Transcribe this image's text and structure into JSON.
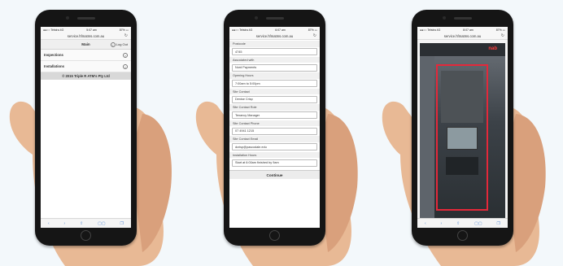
{
  "phones": [
    {
      "status": {
        "carrier": "●●○○ Telstra 4G",
        "time": "5:07 am",
        "battery": "87% ▭"
      },
      "url": "service.hfmatms.com.au",
      "nav": {
        "title": "Main",
        "logout": "Log Out"
      },
      "rows": [
        "Inspections",
        "Installations"
      ],
      "footer": "© 2015 Triple R ATM's Pty Ltd"
    },
    {
      "status": {
        "carrier": "●●○○ Telstra 4G",
        "time": "6:07 am",
        "battery": "87% ▭"
      },
      "url": "service.hfmatms.com.au",
      "fields": [
        {
          "label": "Postcode",
          "value": "4745"
        },
        {
          "label": "Associated with",
          "value": "Nord Payments"
        },
        {
          "label": "Opening Hours",
          "value": "7:00am to 5:00pm"
        },
        {
          "label": "Site Contact",
          "value": "Denise Crisp"
        },
        {
          "label": "Site Contact Role",
          "value": "Tenancy Manager"
        },
        {
          "label": "Site Contact Phone",
          "value": "07 4941 1215"
        },
        {
          "label": "Site Contact Email",
          "value": "dcrisp@pascodale.edu"
        },
        {
          "label": "Installation Hours",
          "value": "Start at 6:00am finished by 9am"
        }
      ],
      "continue": "Continue"
    },
    {
      "status": {
        "carrier": "●●○○ Telstra 4G",
        "time": "8:07 am",
        "battery": "87% ▭"
      },
      "url": "service.hfmatms.com.au",
      "photo_brand": "nab"
    }
  ],
  "browser_icons": [
    "‹",
    "›",
    "⇧",
    "▢▢",
    "❐"
  ],
  "colors": {
    "background": "#f3f8fb",
    "accent": "#e4283a",
    "link": "#5a8ed6"
  }
}
